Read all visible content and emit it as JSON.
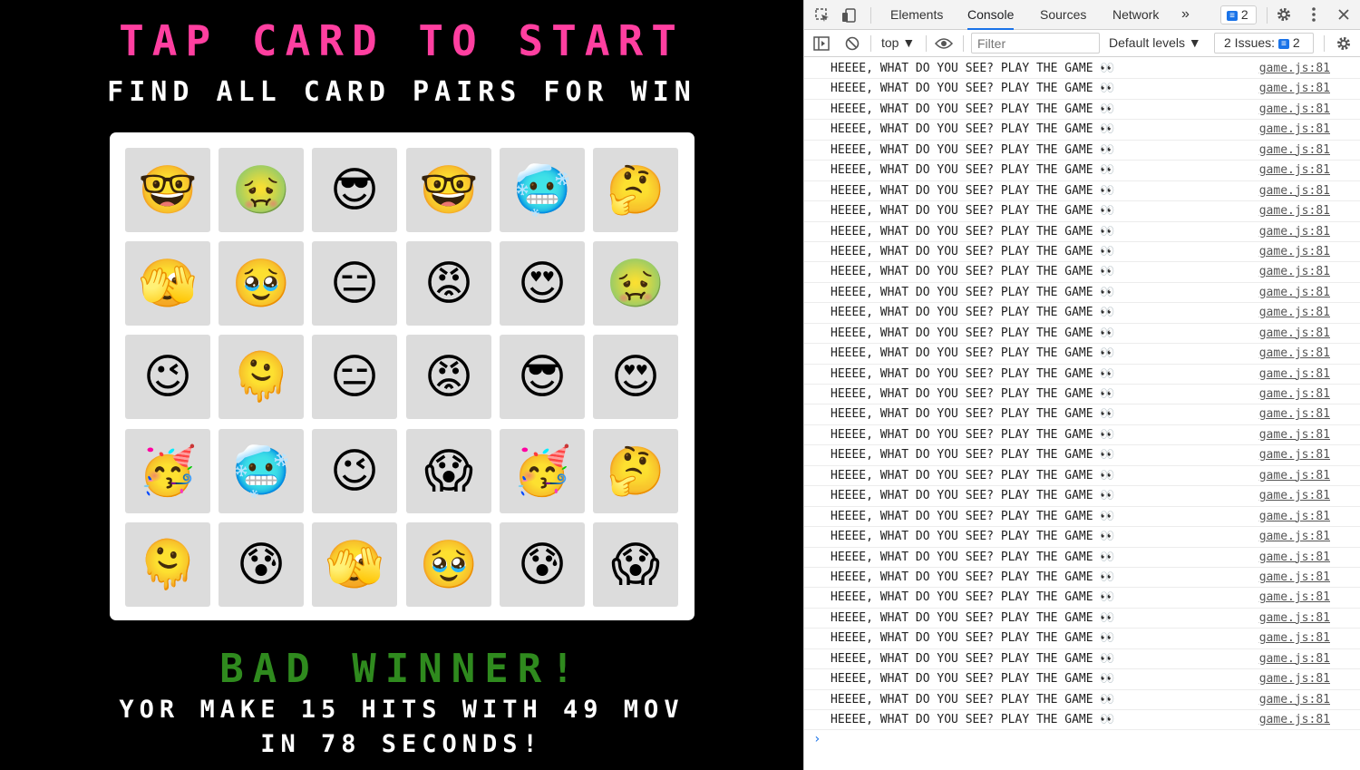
{
  "game": {
    "title": "TAP CARD TO START",
    "subtitle": "FIND ALL CARD PAIRS FOR WIN",
    "cards": [
      [
        "🤓",
        "🤢",
        "😎",
        "🤓",
        "🥶",
        "🤔"
      ],
      [
        "🫣",
        "🥹",
        "😑",
        "😡",
        "😍",
        "🤢"
      ],
      [
        "😉",
        "🫠",
        "😑",
        "😡",
        "😎",
        "😍"
      ],
      [
        "🥳",
        "🥶",
        "😉",
        "😱",
        "🥳",
        "🤔"
      ],
      [
        "🫠",
        "😰",
        "🫣",
        "🥹",
        "😰",
        "😱"
      ]
    ],
    "result_title": "BAD WINNER!",
    "result_text": "YOR MAKE 15 HITS WITH 49 MOV IN 78 SECONDS!"
  },
  "devtools": {
    "tabs": [
      "Elements",
      "Console",
      "Sources",
      "Network"
    ],
    "active_tab": "Console",
    "more_tabs": "»",
    "issues_tab_count": "2",
    "context": "top ▼",
    "filter_placeholder": "Filter",
    "levels": "Default levels ▼",
    "issues_label": "2 Issues:",
    "issues_count": "2",
    "log_message": "HEEEE, WHAT DO YOU SEE? PLAY THE GAME 👀",
    "log_source": "game.js:81",
    "log_count": 33,
    "prompt": "›"
  },
  "colors": {
    "title": "#ff3fa0",
    "result_title": "#2f8a1e",
    "accent": "#1a73e8",
    "card_bg": "#dcdcdc"
  }
}
